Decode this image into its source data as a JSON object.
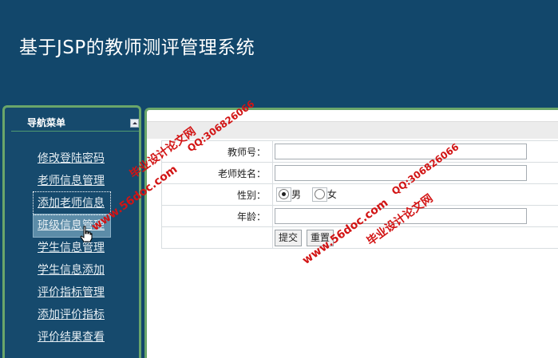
{
  "app": {
    "title": "基于JSP的教师测评管理系统"
  },
  "sidebar": {
    "title": "导航菜单",
    "items": [
      {
        "label": "修改登陆密码"
      },
      {
        "label": "老师信息管理"
      },
      {
        "label": "添加老师信息"
      },
      {
        "label": "班级信息管理"
      },
      {
        "label": "学生信息管理"
      },
      {
        "label": "学生信息添加"
      },
      {
        "label": "评价指标管理"
      },
      {
        "label": "添加评价指标"
      },
      {
        "label": "评价结果查看"
      }
    ]
  },
  "form": {
    "teacher_no_label": "教师号：",
    "teacher_no_value": "",
    "teacher_name_label": "老师姓名：",
    "teacher_name_value": "",
    "gender_label": "性别：",
    "gender_male": "男",
    "gender_female": "女",
    "gender_selected": "男",
    "age_label": "年龄：",
    "age_value": "",
    "submit_label": "提交",
    "reset_label": "重置"
  },
  "watermarks": {
    "site": "www.56doc.com",
    "brand": "毕业设计论文网",
    "qq": "QQ:306826066"
  }
}
